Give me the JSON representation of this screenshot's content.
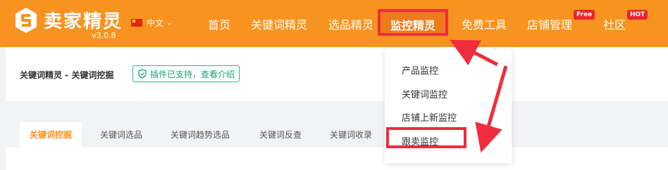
{
  "header": {
    "brand": "卖家精灵",
    "version": "v3.0.8",
    "language": "中文",
    "nav": [
      {
        "label": "首页"
      },
      {
        "label": "关键词精灵"
      },
      {
        "label": "选品精灵"
      },
      {
        "label": "监控精灵",
        "active": true
      },
      {
        "label": "免费工具"
      },
      {
        "label": "店铺管理",
        "badge": "Free"
      },
      {
        "label": "社区",
        "badge": "HOT"
      }
    ]
  },
  "breadcrumb": "关键词精灵 - 关键词挖掘",
  "plugin_tag": "插件已支持，查看介绍",
  "tabs": [
    {
      "label": "关键词挖掘",
      "active": true
    },
    {
      "label": "关键词选品"
    },
    {
      "label": "关键词趋势选品"
    },
    {
      "label": "关键词反查"
    },
    {
      "label": "关键词收录"
    }
  ],
  "dropdown": {
    "items": [
      {
        "label": "产品监控"
      },
      {
        "label": "关键词监控"
      },
      {
        "label": "店铺上新监控"
      },
      {
        "label": "跟卖监控",
        "highlighted": true
      }
    ]
  },
  "colors": {
    "brand_orange": "#f7931e",
    "highlight_red": "#ee2d3d",
    "badge_red": "#e8242e",
    "plugin_green": "#33b58a"
  },
  "icons": [
    "logo-icon",
    "flag-cn-icon",
    "chevron-down-icon",
    "shield-check-icon"
  ]
}
